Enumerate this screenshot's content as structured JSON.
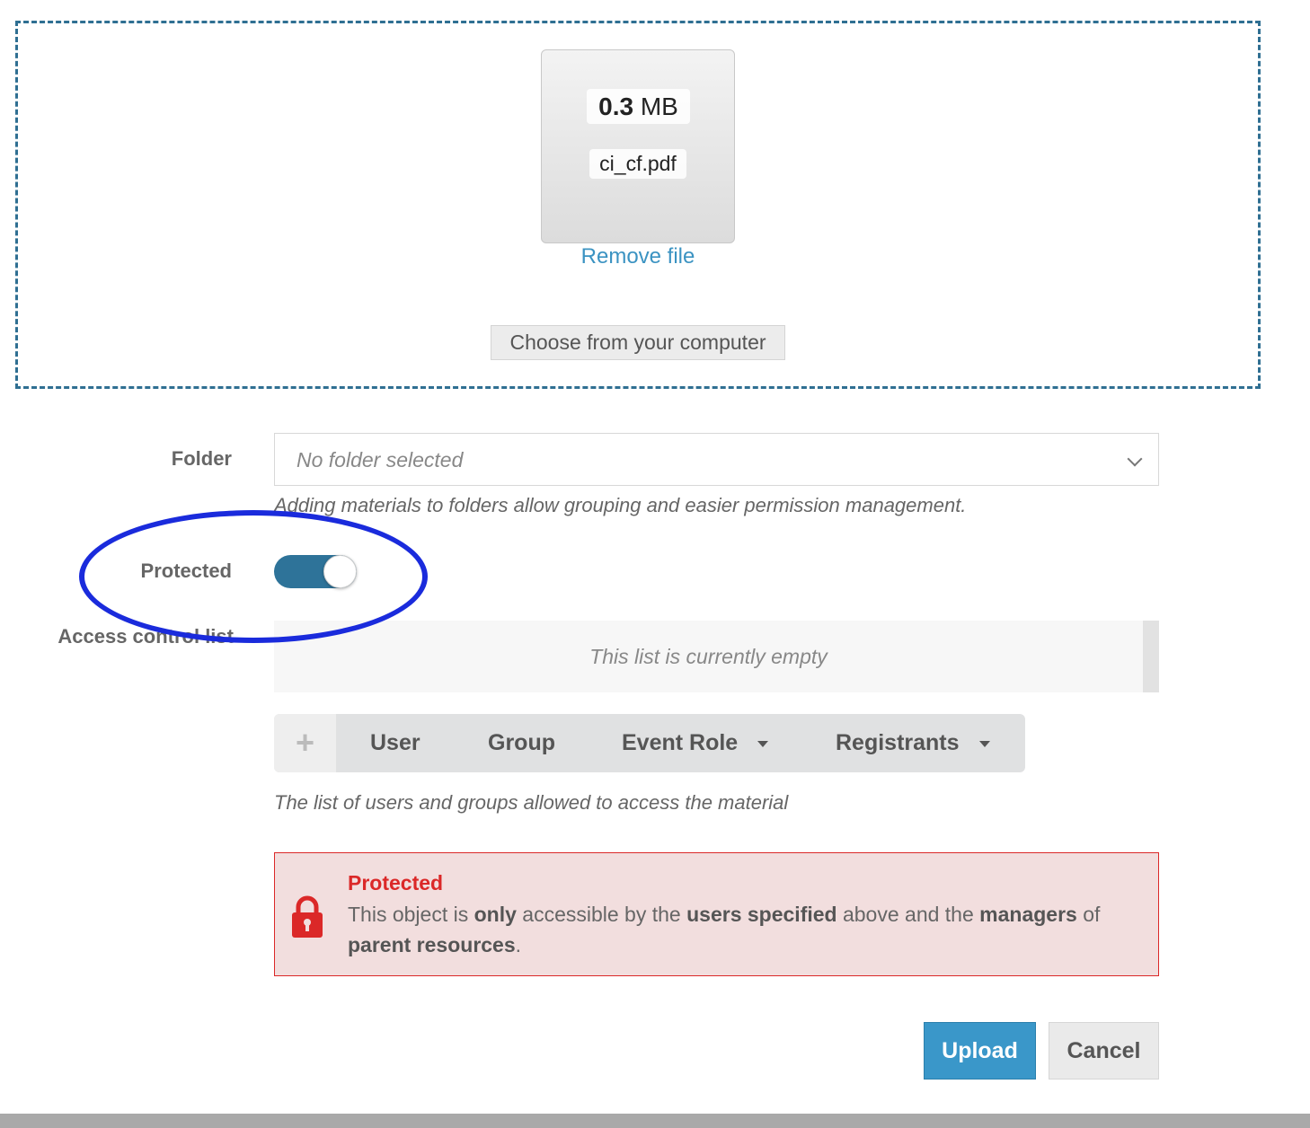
{
  "dropzone": {
    "file": {
      "size_value": "0.3",
      "size_unit": "MB",
      "name": "ci_cf.pdf"
    },
    "remove_label": "Remove file",
    "choose_label": "Choose from your computer"
  },
  "form": {
    "folder": {
      "label": "Folder",
      "placeholder": "No folder selected",
      "help": "Adding materials to folders allow grouping and easier permission management."
    },
    "protected": {
      "label": "Protected",
      "checked": true
    },
    "acl": {
      "label": "Access control list",
      "empty_text": "This list is currently empty",
      "toolbar": {
        "add_icon": "plus-icon",
        "user": "User",
        "group": "Group",
        "event_role": "Event Role",
        "registrants": "Registrants"
      },
      "help": "The list of users and groups allowed to access the material"
    },
    "warning": {
      "icon": "lock-icon",
      "title": "Protected",
      "text_1": "This object is ",
      "b_only": "only",
      "text_2": " accessible by the ",
      "b_users": "users specified",
      "text_3": " above and the ",
      "b_managers": "managers",
      "text_4": " of ",
      "b_parent": "parent resources",
      "text_5": "."
    }
  },
  "actions": {
    "upload": "Upload",
    "cancel": "Cancel"
  },
  "colors": {
    "accent": "#3a97c9",
    "toggle_on": "#2e7399",
    "danger": "#db2828",
    "annotation": "#1a2bdc"
  }
}
